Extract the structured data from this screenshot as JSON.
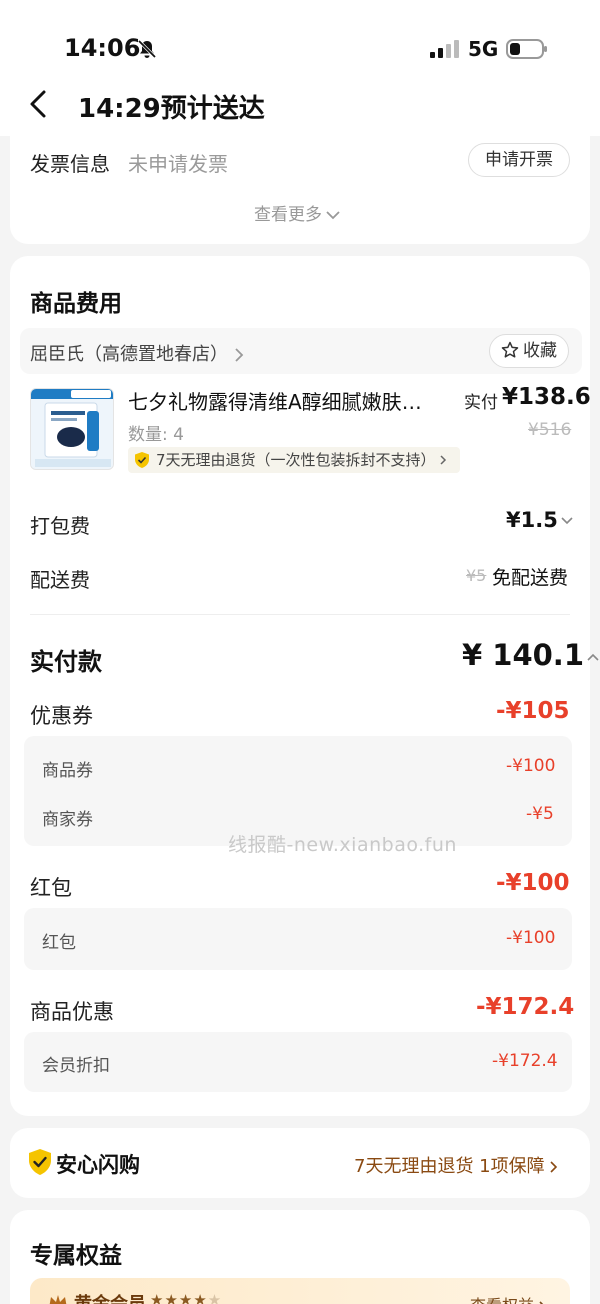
{
  "status_bar": {
    "time": "14:06",
    "network": "5G"
  },
  "nav": {
    "title": "14:29预计送达"
  },
  "invoice": {
    "label": "发票信息",
    "status": "未申请发票",
    "apply_button": "申请开票",
    "more_link": "查看更多"
  },
  "fees": {
    "title": "商品费用",
    "store": {
      "name": "屈臣氏（高德置地春店）",
      "favorite_button": "收藏"
    },
    "product": {
      "name": "七夕礼物露得清维A醇细腻嫩肤精华",
      "quantity": "数量: 4",
      "paid_label": "实付",
      "paid_price": "¥138.6",
      "original_price": "¥516",
      "return_policy": "7天无理由退货（一次性包装拆封不支持）"
    },
    "packing": {
      "label": "打包费",
      "value": "¥1.5"
    },
    "shipping": {
      "label": "配送费",
      "original": "¥5",
      "value": "免配送费"
    },
    "total": {
      "label": "实付款",
      "value": "¥ 140.1"
    },
    "discounts": [
      {
        "label": "优惠券",
        "value": "-¥105",
        "items": [
          {
            "label": "商品券",
            "value": "-¥100"
          },
          {
            "label": "商家券",
            "value": "-¥5"
          }
        ]
      },
      {
        "label": "红包",
        "value": "-¥100",
        "items": [
          {
            "label": "红包",
            "value": "-¥100"
          }
        ]
      },
      {
        "label": "商品优惠",
        "value": "-¥172.4",
        "items": [
          {
            "label": "会员折扣",
            "value": "-¥172.4"
          }
        ]
      }
    ],
    "watermark": "线报酷-new.xianbao.fun"
  },
  "assurance": {
    "title": "安心闪购",
    "info": "7天无理由退货 1项保障"
  },
  "benefits": {
    "title": "专属权益",
    "member_level": "黄金会员",
    "stars": "★★★★",
    "stars_dim": "★",
    "link": "查看权益"
  },
  "colors": {
    "discount_red": "#e8402a",
    "assurance_yellow": "#f5c400",
    "member_gold": "#fde9c8"
  }
}
